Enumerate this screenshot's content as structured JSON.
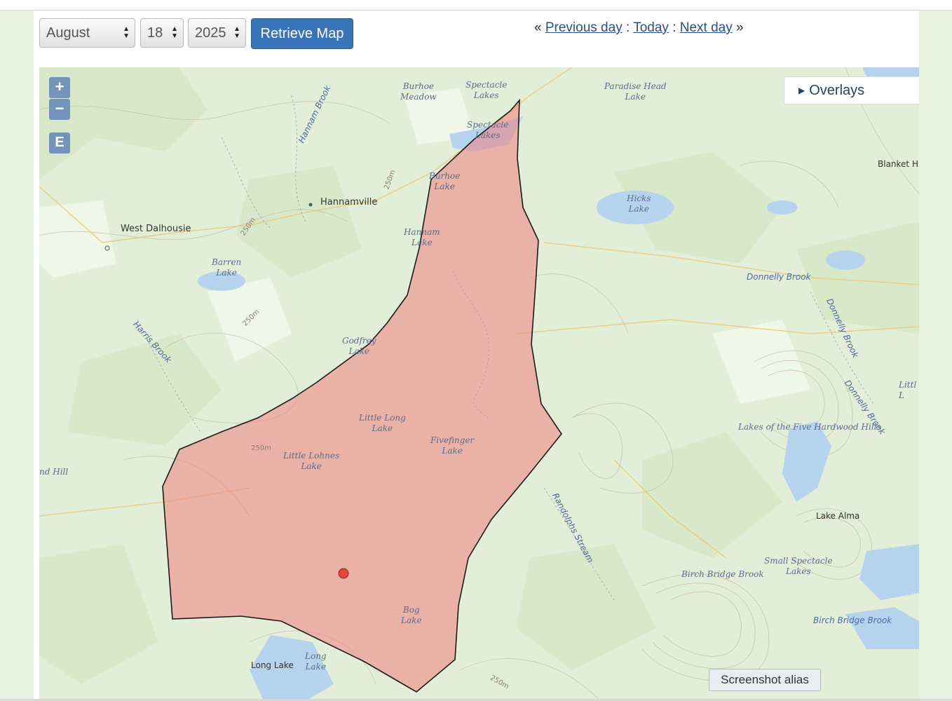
{
  "date_picker": {
    "month": "August",
    "day": "18",
    "year": "2025",
    "retrieve_label": "Retrieve Map"
  },
  "day_nav": {
    "prefix": "«",
    "previous_label": "Previous day",
    "separator": ":",
    "today_label": "Today",
    "next_label": "Next day",
    "suffix": "»"
  },
  "map_controls": {
    "zoom_in": "+",
    "zoom_out": "−",
    "e_button": "E",
    "overlays_label": "Overlays",
    "screenshot_alias_label": "Screenshot alias"
  },
  "map_labels": {
    "burhoe_meadow": "Burhoe\nMeadow",
    "spectacle_lakes_top": "Spectacle\nLakes",
    "spectacle_lakes": "Spectacle\nLakes",
    "paradise_head_lake": "Paradise Head\nLake",
    "hannam_brook": "Hannam Brook",
    "burhoe_lake": "Burhoe\nLake",
    "hannamville": "Hannamville",
    "west_dalhousie": "West Dalhousie",
    "hannam_lake": "Hannam\nLake",
    "barren_lake": "Barren\nLake",
    "hicks_lake": "Hicks\nLake",
    "blanket_h": "Blanket H",
    "donnelly_brook": "Donnelly Brook",
    "donnelly_brook_2": "Donnelly Brook",
    "donnelly_brook_3": "Donnelly Brook",
    "harris_brook": "Harris Brook",
    "godfrey_lake": "Godfrey\nLake",
    "little_long_lake": "Little Long\nLake",
    "fivefinger_lake": "Fivefinger\nLake",
    "little_lohnes_lake": "Little Lohnes\nLake",
    "lakes_five_hardwood": "Lakes of the Five Hardwood Hills",
    "littl": "Littl\nL",
    "nd_hill": "nd Hill",
    "randolphs_stream": "Randolphs Stream",
    "lake_alma": "Lake Alma",
    "small_spectacle_lakes": "Small Spectacle\nLakes",
    "birch_bridge_brook": "Birch Bridge Brook",
    "birch_bridge_brook_2": "Birch Bridge Brook",
    "bog_lake": "Bog\nLake",
    "long_lake_town": "Long Lake",
    "long_lake": "Long\nLake",
    "contour_250_a": "250m",
    "contour_250_b": "250m",
    "contour_250_c": "250m",
    "contour_250_d": "250m",
    "contour_250_e": "250m"
  },
  "colors": {
    "polygon_fill": "#f08080",
    "polygon_stroke": "#1a1a1a",
    "marker": "#e0483a",
    "water": "#b6d3ee",
    "button_blue": "#3a74b8"
  }
}
